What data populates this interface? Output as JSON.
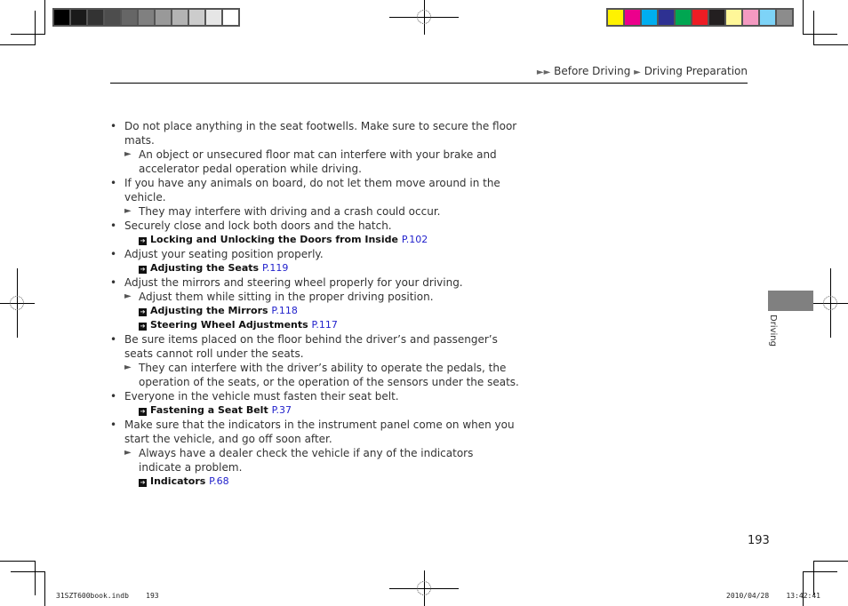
{
  "color_bars": {
    "grayscale": [
      "#000000",
      "#1a1a1a",
      "#333333",
      "#4d4d4d",
      "#666666",
      "#808080",
      "#999999",
      "#b3b3b3",
      "#cccccc",
      "#e6e6e6",
      "#ffffff"
    ],
    "color": [
      "#fff200",
      "#ec008c",
      "#00aeef",
      "#2e3192",
      "#00a651",
      "#ed1c24",
      "#231f20",
      "#fff799",
      "#f49ac1",
      "#7dd3f7",
      "#8c8c8c"
    ]
  },
  "header": {
    "breadcrumb_marker": "►►",
    "breadcrumb_section": "Before Driving",
    "breadcrumb_sep": "►",
    "breadcrumb_page": "Driving Preparation"
  },
  "items": [
    {
      "bullet": "Do not place anything in the seat footwells. Make sure to secure the floor mats.",
      "notes": [
        "An object or unsecured floor mat can interfere with your brake and accelerator pedal operation while driving."
      ],
      "refs": []
    },
    {
      "bullet": "If you have any animals on board, do not let them move around in the vehicle.",
      "notes": [
        "They may interfere with driving and a crash could occur."
      ],
      "refs": []
    },
    {
      "bullet": "Securely close and lock both doors and the hatch.",
      "notes": [],
      "refs": [
        {
          "title": "Locking and Unlocking the Doors from Inside",
          "page": "P.102"
        }
      ]
    },
    {
      "bullet": "Adjust your seating position properly.",
      "notes": [],
      "refs": [
        {
          "title": "Adjusting the Seats",
          "page": "P.119"
        }
      ]
    },
    {
      "bullet": "Adjust the mirrors and steering wheel properly for your driving.",
      "notes": [
        "Adjust them while sitting in the proper driving position."
      ],
      "refs": [
        {
          "title": "Adjusting the Mirrors",
          "page": "P.118"
        },
        {
          "title": "Steering Wheel Adjustments",
          "page": "P.117"
        }
      ]
    },
    {
      "bullet": "Be sure items placed on the floor behind the driver’s and passenger’s seats cannot roll under the seats.",
      "notes": [
        "They can interfere with the driver’s ability to operate the pedals, the operation of the seats, or the operation of the sensors under the seats."
      ],
      "refs": []
    },
    {
      "bullet": "Everyone in the vehicle must fasten their seat belt.",
      "notes": [],
      "refs": [
        {
          "title": "Fastening a Seat Belt",
          "page": "P.37"
        }
      ]
    },
    {
      "bullet": "Make sure that the indicators in the instrument panel come on when you start the vehicle, and go off soon after.",
      "notes": [
        "Always have a dealer check the vehicle if any of the indicators indicate a problem."
      ],
      "refs": [
        {
          "title": "Indicators",
          "page": "P.68"
        }
      ]
    }
  ],
  "symbols": {
    "bullet": "•",
    "note_marker": "►",
    "ref_marker": "➔"
  },
  "side_tab": {
    "label": "Driving"
  },
  "page_number": "193",
  "slug": {
    "file": "31SZT600book.indb",
    "page": "193",
    "date": "2010/04/28",
    "time": "13:42:41"
  }
}
